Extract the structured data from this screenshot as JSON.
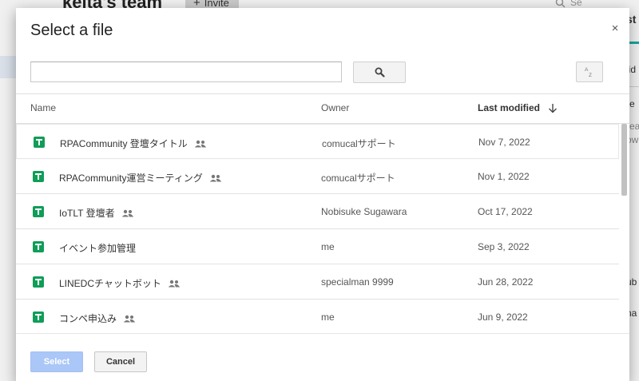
{
  "background": {
    "team_title": "keita's team",
    "invite_label": "Invite",
    "search_hint": "Se",
    "right_fragments": [
      "st",
      "lid",
      "re",
      "rea",
      "ow",
      "ub",
      "na"
    ]
  },
  "dialog": {
    "title": "Select a file",
    "close_glyph": "×",
    "search": {
      "value": "",
      "placeholder": ""
    },
    "sort_label": "AZ",
    "columns": {
      "name": "Name",
      "owner": "Owner",
      "modified": "Last modified"
    },
    "files": [
      {
        "name": "RPACommunity 登壇タイトル",
        "shared": true,
        "owner": "comucalサポート",
        "modified": "Nov 7, 2022"
      },
      {
        "name": "RPACommunity運営ミーティング",
        "shared": true,
        "owner": "comucalサポート",
        "modified": "Nov 1, 2022"
      },
      {
        "name": "IoTLT 登壇者",
        "shared": true,
        "owner": "Nobisuke Sugawara",
        "modified": "Oct 17, 2022"
      },
      {
        "name": "イベント参加管理",
        "shared": false,
        "owner": "me",
        "modified": "Sep 3, 2022"
      },
      {
        "name": "LINEDCチャットボット",
        "shared": true,
        "owner": "specialman 9999",
        "modified": "Jun 28, 2022"
      },
      {
        "name": "コンペ申込み",
        "shared": true,
        "owner": "me",
        "modified": "Jun 9, 2022"
      }
    ],
    "buttons": {
      "select": "Select",
      "cancel": "Cancel"
    }
  },
  "colors": {
    "sheets_green": "#0f9d58",
    "select_button": "#aac7f7",
    "teal_accent": "#19b0a8"
  },
  "icons": {
    "search": "magnifier-icon",
    "sort": "sort-az-icon",
    "sheet": "google-sheets-icon",
    "shared": "people-icon",
    "arrow": "arrow-down-icon"
  }
}
